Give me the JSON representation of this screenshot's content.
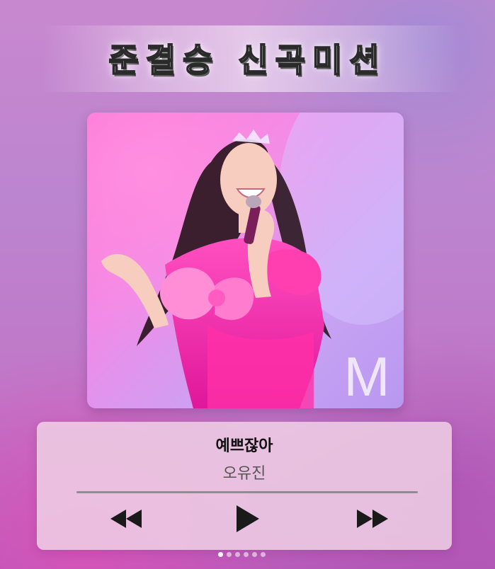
{
  "header": {
    "title": "준결승 신곡미션"
  },
  "album": {
    "image_alt": "Performer in pink ruffled dress singing into a microphone on stage",
    "watermark": "M"
  },
  "player": {
    "song_title": "예쁘잖아",
    "artist": "오유진",
    "progress": 0,
    "controls": {
      "previous_icon": "rewind-icon",
      "play_icon": "play-icon",
      "next_icon": "fast-forward-icon"
    }
  },
  "pagination": {
    "total": 6,
    "current": 1
  },
  "colors": {
    "card_bg": "#eecde4",
    "accent_pink": "#ff3fb0",
    "control": "#1a1a1a"
  }
}
